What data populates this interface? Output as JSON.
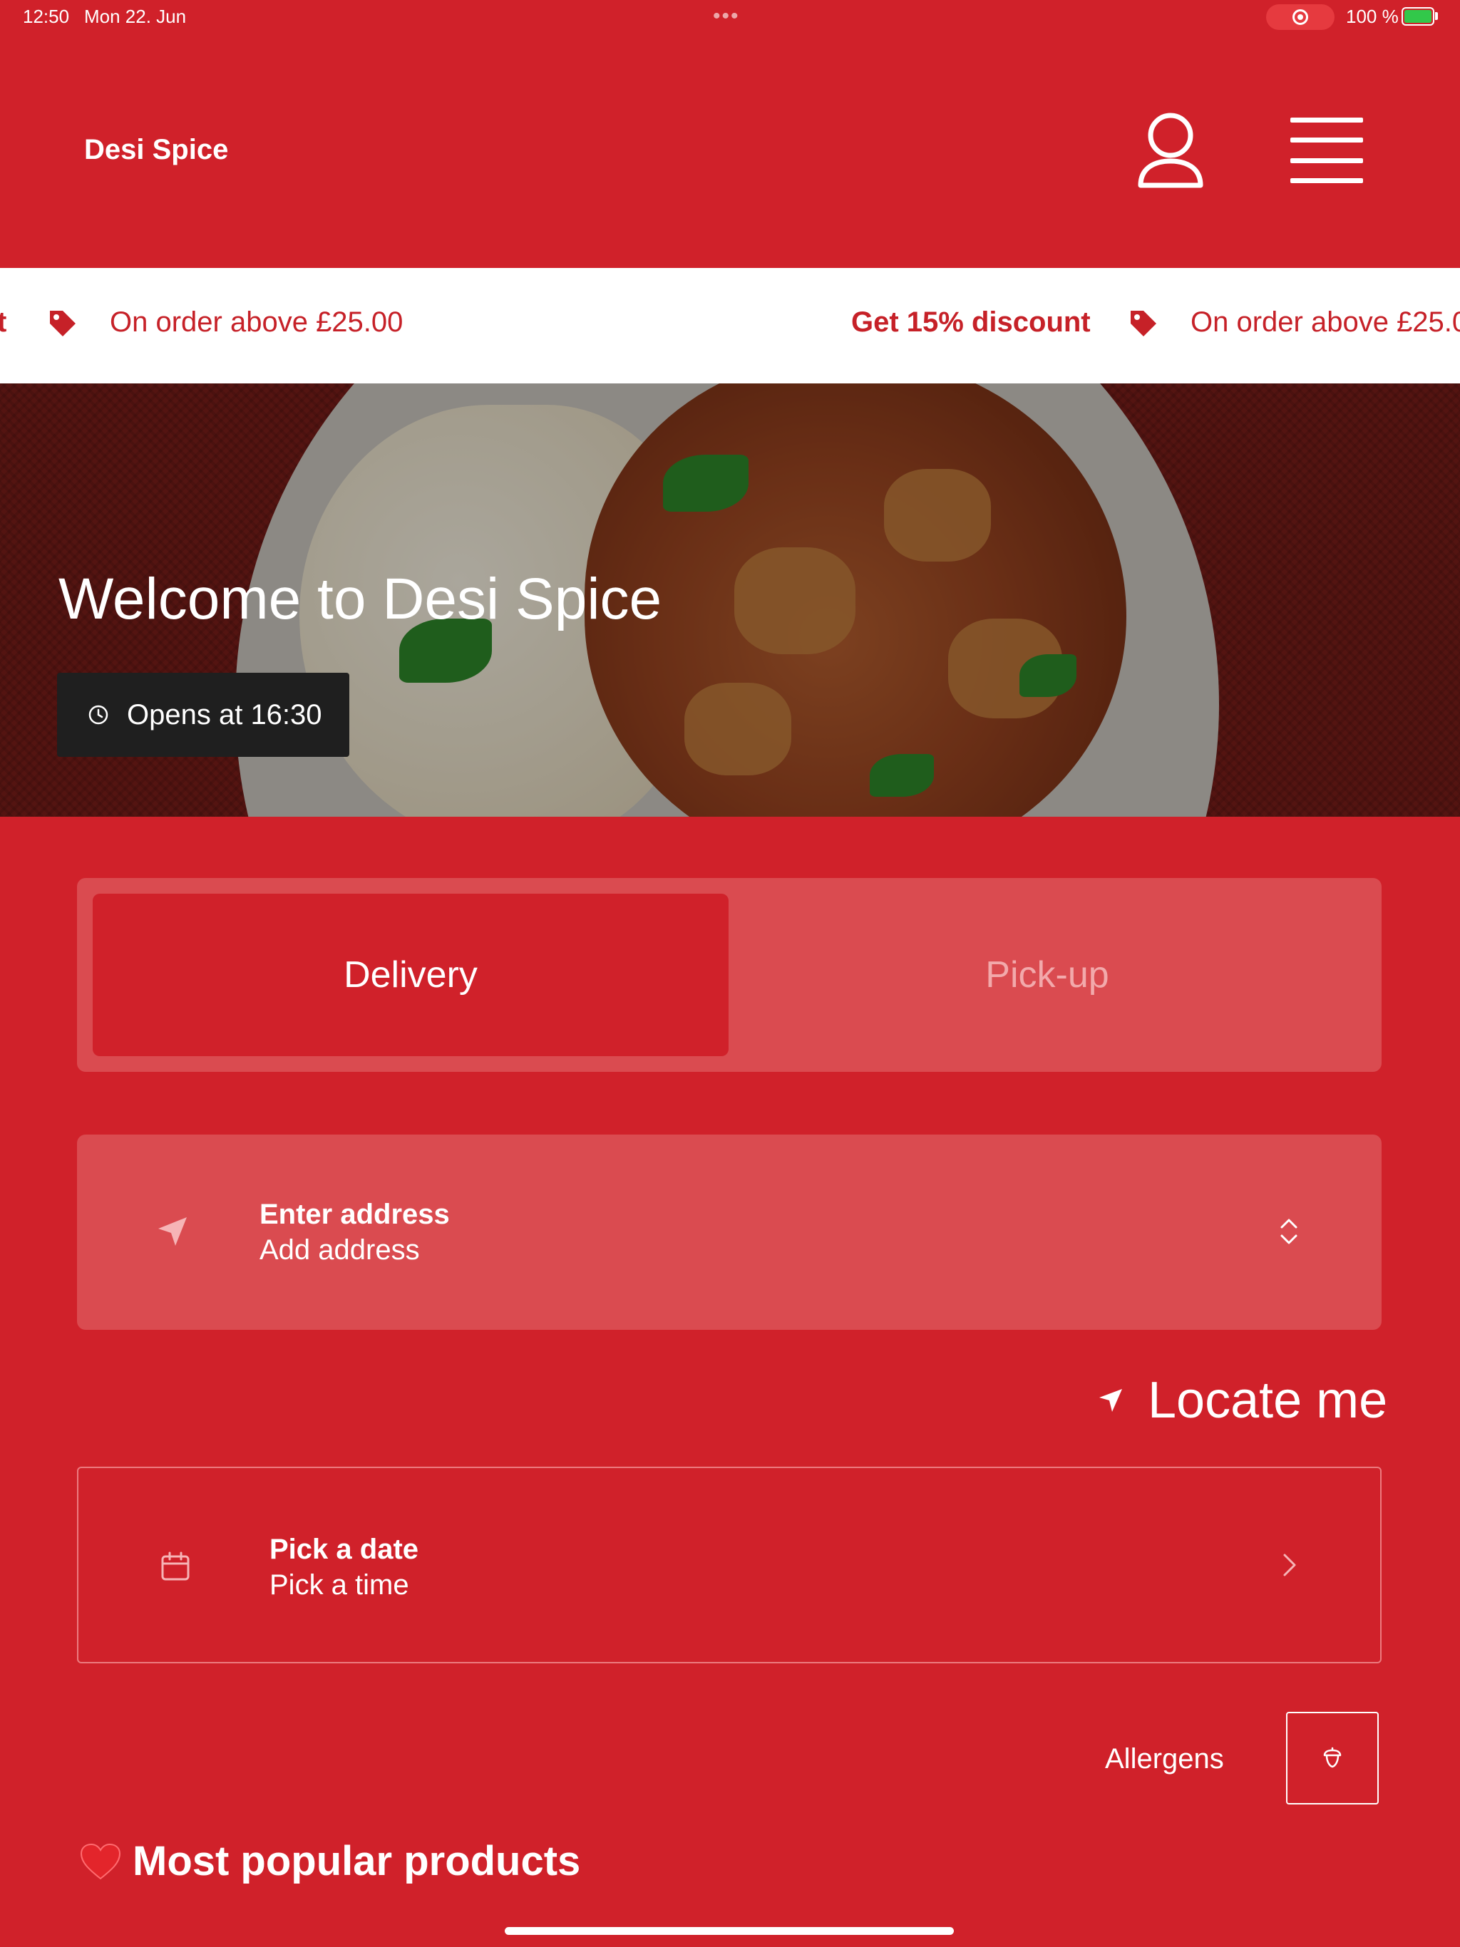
{
  "status_bar": {
    "time": "12:50",
    "date": "Mon 22. Jun",
    "battery": "100 %",
    "battery_level": 1.0
  },
  "header": {
    "brand": "Desi Spice",
    "profile_icon": "person-icon",
    "menu_icon": "hamburger-menu-icon"
  },
  "promo": {
    "items": [
      {
        "bold": "t",
        "text": "On order above £25.00"
      },
      {
        "bold": "Get 15% discount",
        "text": "On order above £25.0"
      }
    ],
    "icon": "tag-icon"
  },
  "hero": {
    "title": "Welcome to Desi Spice",
    "hours": "Opens at 16:30"
  },
  "order_type": {
    "options": [
      "Delivery",
      "Pick-up"
    ],
    "selected": "Delivery"
  },
  "address": {
    "title": "Enter address",
    "subtitle": "Add address"
  },
  "locate": {
    "label": "Locate me"
  },
  "datetime": {
    "title": "Pick a date",
    "subtitle": "Pick a time"
  },
  "allergens": {
    "label": "Allergens"
  },
  "popular": {
    "title": "Most popular products",
    "emoji": "❤️"
  },
  "colors": {
    "brand_red": "#d0212a",
    "panel": "#da4b50",
    "promo_text": "#c62128",
    "badge_bg": "#1f1f1f"
  }
}
